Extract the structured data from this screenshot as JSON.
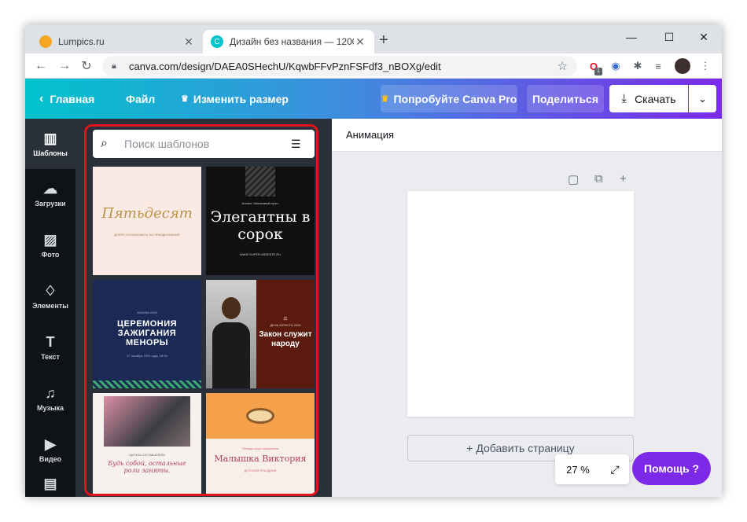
{
  "browser": {
    "tabs": [
      {
        "title": "Lumpics.ru",
        "favicon_color": "#f5a623"
      },
      {
        "title": "Дизайн без названия — 1200 ×",
        "favicon_color": "#00c4cc"
      }
    ],
    "new_tab": "+",
    "window_controls": {
      "minimize": "—",
      "maximize": "☐",
      "close": "✕"
    },
    "url": "canva.com/design/DAEA0SHechU/KqwbFFvPznFSFdf3_nBOXg/edit",
    "extension_badge": "1"
  },
  "canva_header": {
    "home": "Главная",
    "file": "Файл",
    "resize": "Изменить размер",
    "try_pro": "Попробуйте Canva Pro",
    "share": "Поделиться",
    "download": "Скачать"
  },
  "rail": {
    "items": [
      {
        "label": "Шаблоны",
        "icon": "templates-icon",
        "glyph": "▥"
      },
      {
        "label": "Загрузки",
        "icon": "cloud-upload-icon",
        "glyph": "☁"
      },
      {
        "label": "Фото",
        "icon": "image-icon",
        "glyph": "▨"
      },
      {
        "label": "Элементы",
        "icon": "shapes-icon",
        "glyph": "♢"
      },
      {
        "label": "Текст",
        "icon": "text-icon",
        "glyph": "T"
      },
      {
        "label": "Музыка",
        "icon": "music-icon",
        "glyph": "♫"
      },
      {
        "label": "Видео",
        "icon": "video-icon",
        "glyph": "▶"
      }
    ]
  },
  "search": {
    "placeholder": "Поиск шаблонов"
  },
  "templates": [
    {
      "title": "Пятьдесят",
      "caption": "ДОБРО ПОЖАЛОВАТЬ НА ПРАЗДНОВАНИЕ"
    },
    {
      "pre": "Ателье «Шелковый путь»",
      "title": "Элегантны в сорок",
      "caption": "WWW.SUPER-WEBSITE.RU"
    },
    {
      "pre": "ХАНУКА 2020",
      "title": "ЦЕРЕМОНИЯ ЗАЖИГАНИЯ МЕНОРЫ",
      "caption": "17 октября 2020 года, 18:00"
    },
    {
      "pre": "ДЕНЬ ЮРИСТА 2020",
      "title": "Закон служит народу"
    },
    {
      "pre": "ЦИТАТА СО СМЫСЛОМ",
      "title": "Будь собой, остальные роли заняты."
    },
    {
      "pre": "Птенцы скоро вылупятся",
      "title": "Малышка Виктория",
      "caption": "ДЕТСКИЙ ПРАЗДНИК"
    }
  ],
  "editor": {
    "toolbar_label": "Анимация",
    "add_page": "+ Добавить страницу",
    "zoom": "27 %",
    "help": "Помощь ?"
  }
}
